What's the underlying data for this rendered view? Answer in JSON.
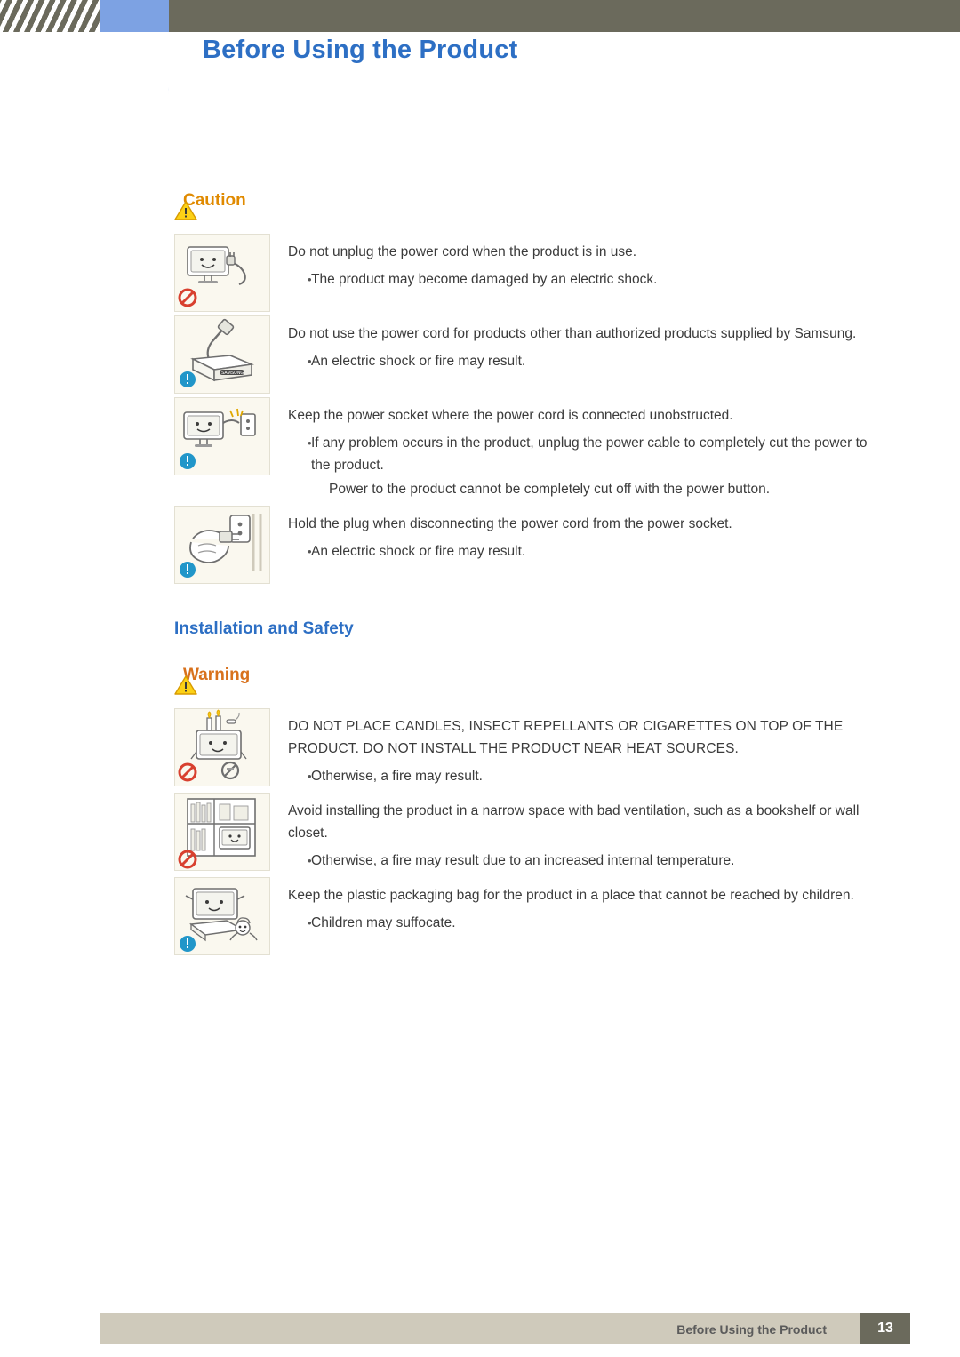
{
  "header": {
    "title": "Before Using the Product"
  },
  "caution": {
    "label": "Caution",
    "icon": "warning-triangle-icon",
    "items": [
      {
        "figure": "monitor-unplug-power-cord-prohibited",
        "paragraph": "Do not unplug the power cord when the product is in use.",
        "bullets": [
          "The product may become damaged by an electric shock."
        ]
      },
      {
        "figure": "power-plug-samsung-box-mandatory",
        "paragraph": "Do not use the power cord for products other than authorized products supplied by Samsung.",
        "bullets": [
          "An electric shock or fire may result."
        ]
      },
      {
        "figure": "monitor-power-socket-unobstructed",
        "paragraph": "Keep the power socket where the power cord is connected unobstructed.",
        "bullets": [
          "If any problem occurs in the product, unplug the power cable to completely cut the power to the product."
        ],
        "note": "Power to the product cannot be completely cut off with the power button."
      },
      {
        "figure": "hand-holding-plug-wall-socket",
        "paragraph": "Hold the plug when disconnecting the power cord from the power socket.",
        "bullets": [
          "An electric shock or fire may result."
        ]
      }
    ]
  },
  "section": {
    "title": "Installation and Safety"
  },
  "warning": {
    "label": "Warning",
    "icon": "warning-triangle-icon",
    "items": [
      {
        "figure": "candles-on-monitor-prohibited",
        "paragraph": "DO NOT PLACE CANDLES, INSECT REPELLANTS OR CIGARETTES ON TOP OF THE PRODUCT. DO NOT INSTALL THE PRODUCT NEAR HEAT SOURCES.",
        "bullets": [
          "Otherwise, a fire may result."
        ]
      },
      {
        "figure": "monitor-in-bookshelf-prohibited",
        "paragraph": "Avoid installing the product in a narrow space with bad ventilation, such as a bookshelf or wall closet.",
        "bullets": [
          "Otherwise, a fire may result due to an increased internal temperature."
        ]
      },
      {
        "figure": "child-with-plastic-bag-mandatory",
        "paragraph": "Keep the plastic packaging bag for the product in a place that cannot be reached by children.",
        "bullets": [
          "Children may suffocate."
        ]
      }
    ]
  },
  "footer": {
    "text": "Before Using the Product",
    "page": "13"
  },
  "colors": {
    "header_band": "#6b6a5c",
    "blue_tab": "#7da2e3",
    "title_blue": "#2d6fc4",
    "caution_orange": "#e08a00",
    "warning_orange": "#d8711c",
    "footer_band": "#cfcabb"
  }
}
